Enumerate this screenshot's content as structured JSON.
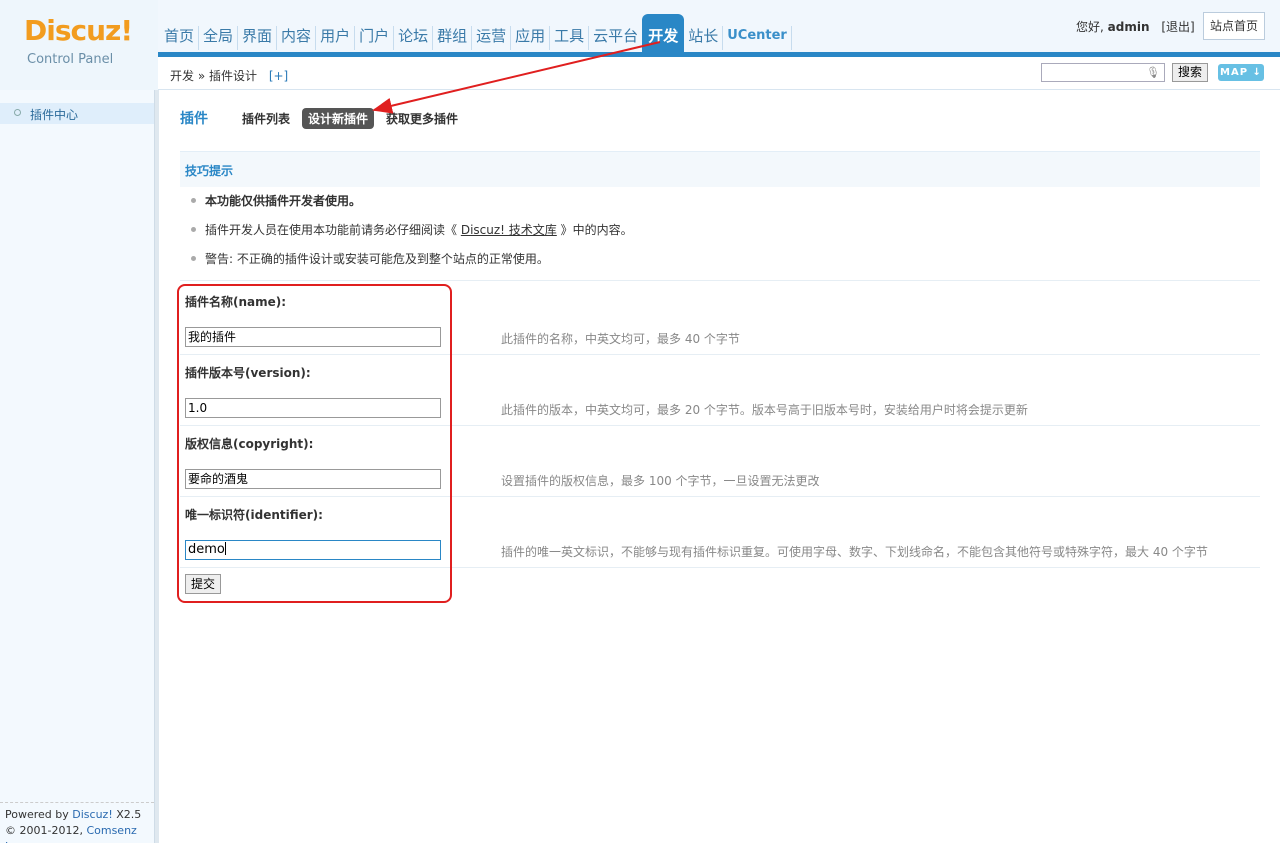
{
  "header": {
    "logo_text": "Discuz!",
    "logo_sub": "Control Panel",
    "nav": [
      "首页",
      "全局",
      "界面",
      "内容",
      "用户",
      "门户",
      "论坛",
      "群组",
      "运营",
      "应用",
      "工具",
      "云平台",
      "开发",
      "站长",
      "UCenter"
    ],
    "active_nav": "开发",
    "greeting": "您好,",
    "username": "admin",
    "logout": "[退出]",
    "site_home": "站点首页"
  },
  "crumbbar": {
    "crumb": "开发 » 插件设计",
    "plus": "[+]",
    "search_placeholder": "",
    "search_button": "搜索",
    "map_button": "MAP ↓"
  },
  "sidebar": {
    "item": "插件中心",
    "footer_line1_prefix": "Powered by",
    "footer_line1_brand": "Discuz!",
    "footer_line1_version": "X2.5",
    "footer_line2_prefix": "© 2001-2012,",
    "footer_line2_company": "Comsenz Inc."
  },
  "main": {
    "title": "插件",
    "tabs": [
      "插件列表",
      "设计新插件",
      "获取更多插件"
    ],
    "active_tab": "设计新插件",
    "tips_title": "技巧提示",
    "tips": {
      "t1": "本功能仅供插件开发者使用。",
      "t2_prefix": "插件开发人员在使用本功能前请务必仔细阅读《",
      "t2_link": "Discuz! 技术文库",
      "t2_suffix": "》中的内容。",
      "t3": "警告: 不正确的插件设计或安装可能危及到整个站点的正常使用。"
    },
    "fields": [
      {
        "label": "插件名称(name):",
        "value": "我的插件",
        "hint": "此插件的名称，中英文均可，最多 40 个字节"
      },
      {
        "label": "插件版本号(version):",
        "value": "1.0",
        "hint": "此插件的版本，中英文均可，最多 20 个字节。版本号高于旧版本号时，安装给用户时将会提示更新"
      },
      {
        "label": "版权信息(copyright):",
        "value": "要命的酒鬼",
        "hint": "设置插件的版权信息，最多 100 个字节，一旦设置无法更改"
      },
      {
        "label": "唯一标识符(identifier):",
        "value": "demo",
        "hint": "插件的唯一英文标识，不能够与现有插件标识重复。可使用字母、数字、下划线命名，不能包含其他符号或特殊字符，最大 40 个字节"
      }
    ],
    "submit": "提交"
  },
  "annotation_color": "#e01f1f"
}
